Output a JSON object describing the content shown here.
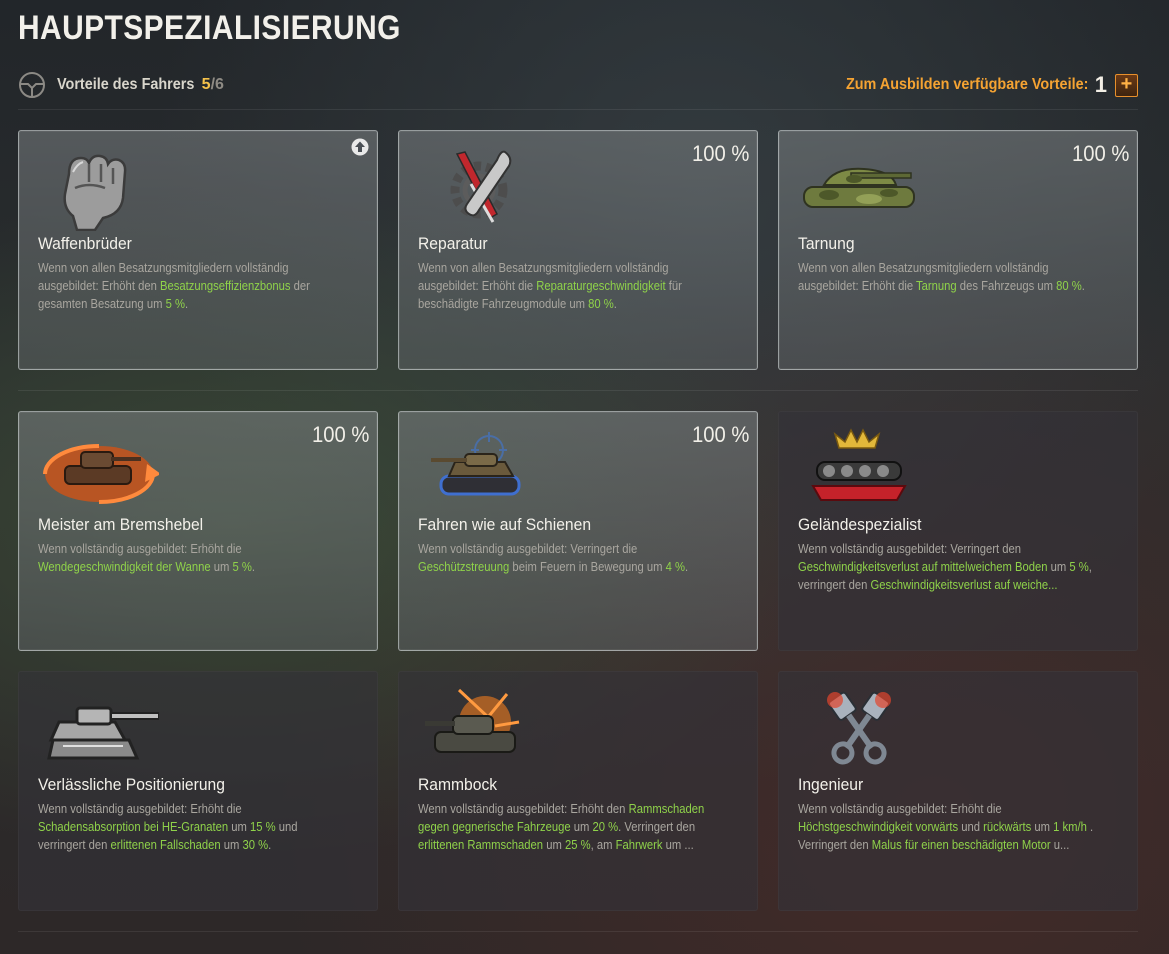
{
  "page_title": "HAUPTSPEZIALISIERUNG",
  "header": {
    "role_label": "Vorteile des Fahrers",
    "count_current": "5",
    "count_sep": "/",
    "count_total": "6",
    "available_label": "Zum Ausbilden verfügbare Vorteile:",
    "available_count": "1",
    "plus_label": "+"
  },
  "colors": {
    "highlight": "#8fd24a",
    "accent_orange": "#f5a332",
    "count_yellow": "#f5c24a"
  },
  "perks": [
    {
      "name": "Waffenbrüder",
      "icon": "clenched-fist-icon",
      "trained": true,
      "percent": "",
      "badge": "upgrade-arrow-icon",
      "desc": [
        "Wenn von allen Besatzungsmitgliedern vollständig ausgebildet: Erhöht den ",
        {
          "hl": "Besatzungseffizienzbonus"
        },
        " der gesamten Besatzung um ",
        {
          "hl": "5 %"
        },
        "."
      ]
    },
    {
      "name": "Reparatur",
      "icon": "wrench-screwdriver-gear-icon",
      "trained": true,
      "percent": "100 %",
      "desc": [
        "Wenn von allen Besatzungsmitgliedern vollständig ausgebildet: Erhöht die ",
        {
          "hl": "Reparaturgeschwindigkeit"
        },
        " für beschädigte Fahrzeugmodule um ",
        {
          "hl": "80 %"
        },
        "."
      ]
    },
    {
      "name": "Tarnung",
      "icon": "camouflage-tank-icon",
      "trained": true,
      "percent": "100 %",
      "desc": [
        "Wenn von allen Besatzungsmitgliedern vollständig ausgebildet: Erhöht die ",
        {
          "hl": "Tarnung"
        },
        " des Fahrzeugs um ",
        {
          "hl": "80 %"
        },
        "."
      ]
    },
    {
      "name": "Meister am Bremshebel",
      "icon": "rotating-tank-icon",
      "trained": true,
      "percent": "100 %",
      "desc": [
        "Wenn vollständig ausgebildet: Erhöht die ",
        {
          "hl": "Wendegeschwindigkeit der Wanne"
        },
        " um ",
        {
          "hl": "5 %"
        },
        "."
      ]
    },
    {
      "name": "Fahren wie auf Schienen",
      "icon": "tank-crosshair-icon",
      "trained": true,
      "percent": "100 %",
      "desc": [
        "Wenn vollständig ausgebildet: Verringert die ",
        {
          "hl": "Geschützstreuung"
        },
        " beim Feuern in Bewegung um ",
        {
          "hl": "4 %"
        },
        "."
      ]
    },
    {
      "name": "Geländespezialist",
      "icon": "crowned-tracks-icon",
      "trained": false,
      "percent": "",
      "desc": [
        "Wenn vollständig ausgebildet: Verringert den ",
        {
          "hl": "Geschwindigkeitsverlust auf mittelweichem Boden"
        },
        " um ",
        {
          "hl": "5 %"
        },
        ", verringert den ",
        {
          "hl": "Geschwindigkeitsverlust auf weiche..."
        }
      ]
    },
    {
      "name": "Verlässliche Positionierung",
      "icon": "armored-tank-icon",
      "trained": false,
      "percent": "",
      "desc": [
        "Wenn vollständig ausgebildet: Erhöht die ",
        {
          "hl": "Schadensabsorption bei HE-Granaten"
        },
        " um ",
        {
          "hl": "15 %"
        },
        " und verringert den ",
        {
          "hl": "erlittenen Fallschaden"
        },
        " um ",
        {
          "hl": "30 %"
        },
        "."
      ]
    },
    {
      "name": "Rammbock",
      "icon": "ramming-tank-icon",
      "trained": false,
      "percent": "",
      "desc": [
        "Wenn vollständig ausgebildet: Erhöht den ",
        {
          "hl": "Rammschaden gegen gegnerische Fahrzeuge"
        },
        " um ",
        {
          "hl": "20 %"
        },
        ". Verringert den ",
        {
          "hl": "erlittenen Rammschaden"
        },
        " um ",
        {
          "hl": "25 %"
        },
        ", am ",
        {
          "hl": "Fahrwerk"
        },
        " um ..."
      ]
    },
    {
      "name": "Ingenieur",
      "icon": "engine-pistons-icon",
      "trained": false,
      "percent": "",
      "desc": [
        "Wenn vollständig ausgebildet: Erhöht die ",
        {
          "hl": "Höchstgeschwindigkeit vorwärts"
        },
        " und ",
        {
          "hl": "rückwärts"
        },
        " um ",
        {
          "hl": "1 km/h"
        },
        " . Verringert den ",
        {
          "hl": "Malus für einen beschädigten Motor"
        },
        " u..."
      ]
    }
  ]
}
